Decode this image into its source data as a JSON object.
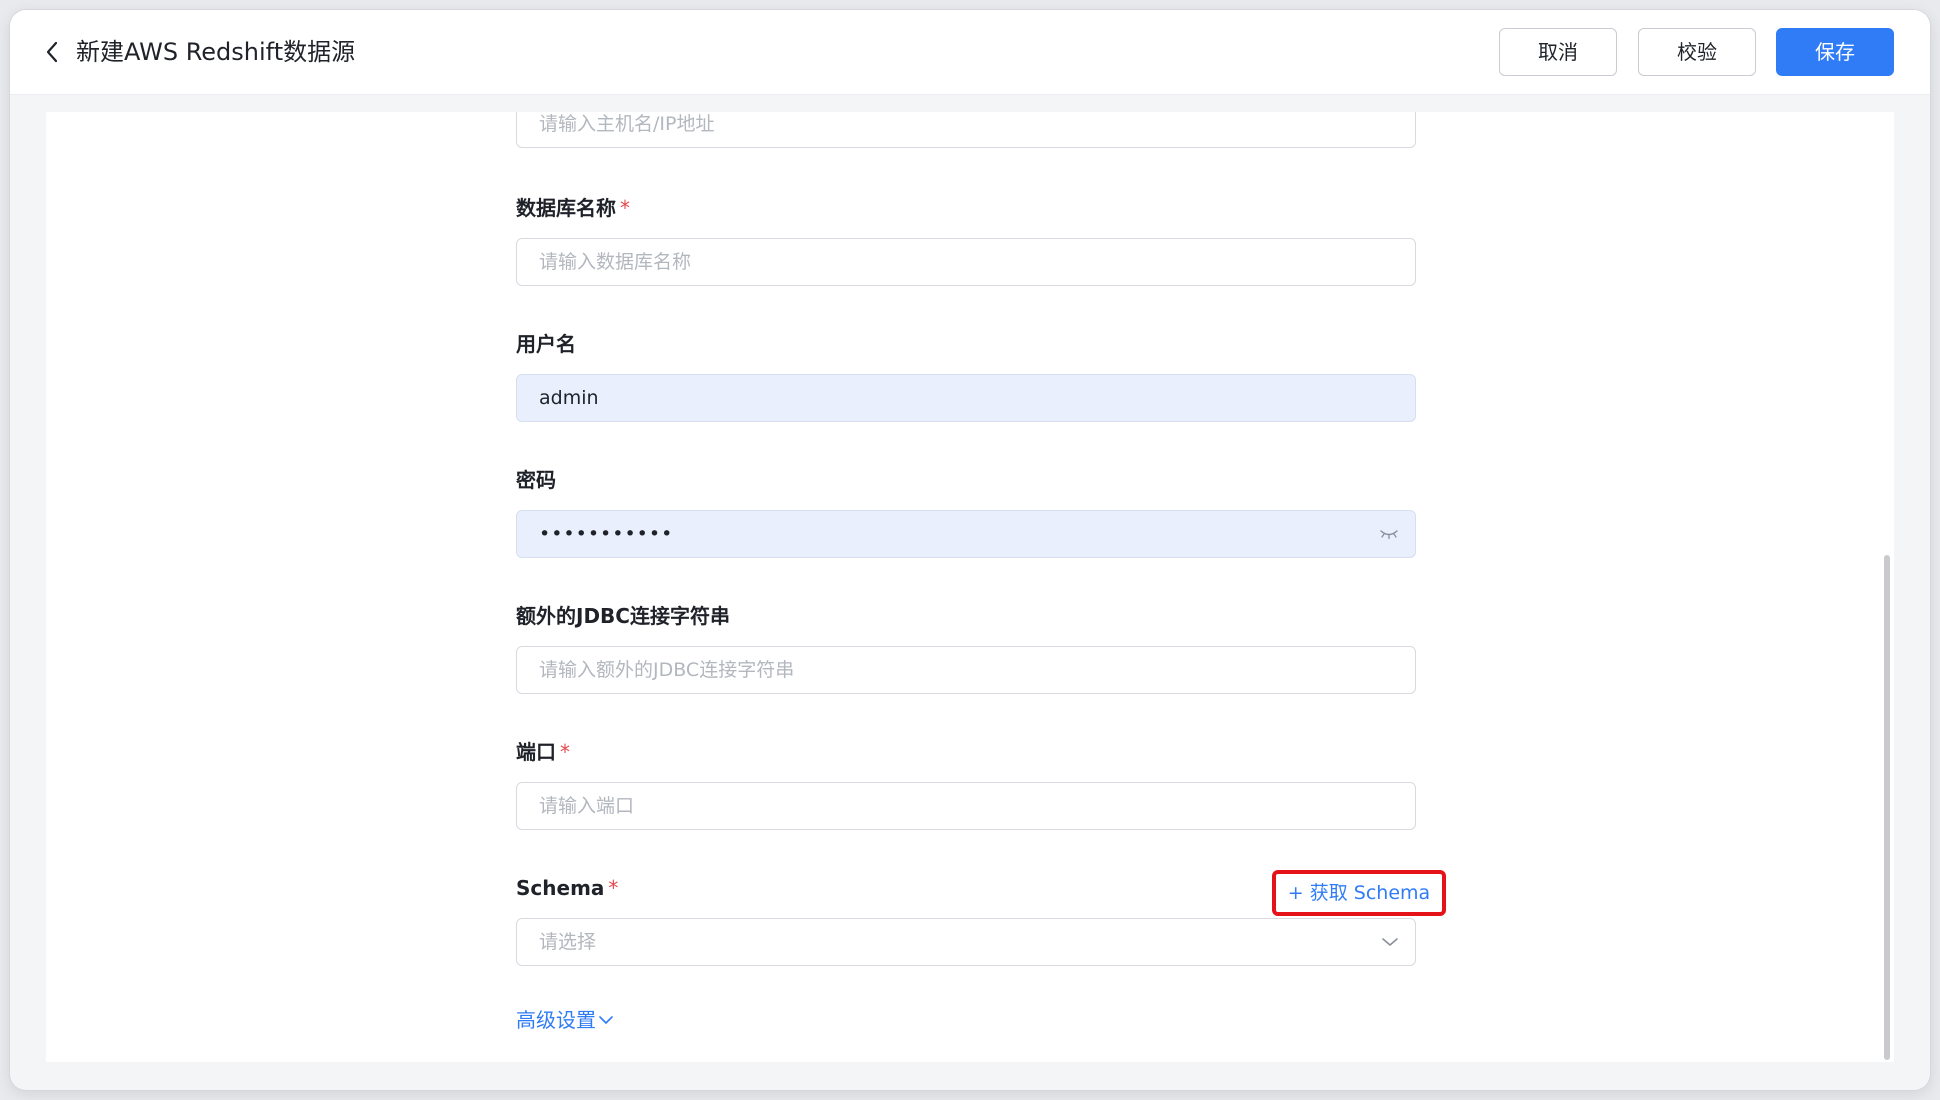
{
  "header": {
    "title": "新建AWS Redshift数据源",
    "cancel_label": "取消",
    "validate_label": "校验",
    "save_label": "保存"
  },
  "form": {
    "host": {
      "placeholder": "请输入主机名/IP地址"
    },
    "database": {
      "label": "数据库名称",
      "required": true,
      "placeholder": "请输入数据库名称"
    },
    "username": {
      "label": "用户名",
      "value": "admin"
    },
    "password": {
      "label": "密码",
      "value": "•••••••••••",
      "icon": "eye-closed-icon"
    },
    "jdbc": {
      "label": "额外的JDBC连接字符串",
      "placeholder": "请输入额外的JDBC连接字符串"
    },
    "port": {
      "label": "端口",
      "required": true,
      "placeholder": "请输入端口"
    },
    "schema": {
      "label": "Schema",
      "required": true,
      "placeholder": "请选择",
      "fetch_label": "+ 获取 Schema"
    },
    "advanced_label": "高级设置",
    "required_mark": "*"
  },
  "colors": {
    "primary": "#2f7cf6",
    "required": "#e5484d",
    "highlight_box": "#e6121a",
    "filled_bg": "#e9effc"
  }
}
